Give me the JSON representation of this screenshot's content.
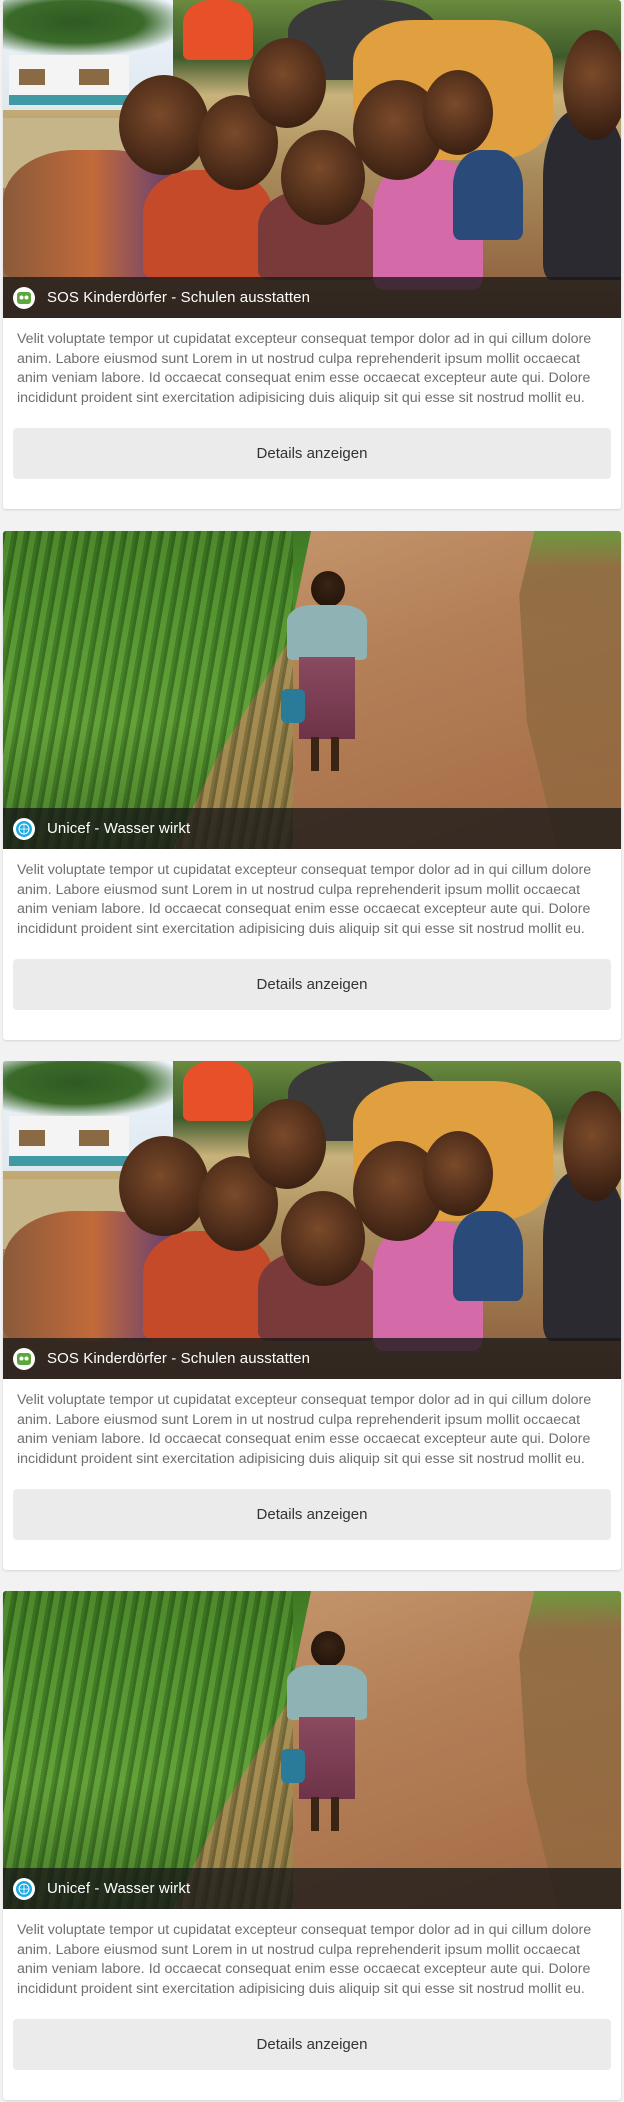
{
  "feed": {
    "cards": [
      {
        "title": "SOS Kinderdörfer - Schulen ausstatten",
        "logo": "sos-kinderdorf-logo",
        "image": "children-group-photo",
        "text": "Velit voluptate tempor ut cupidatat excepteur consequat tempor dolor ad in qui cillum dolore anim. Labore eiusmod sunt Lorem in ut nostrud culpa reprehenderit ipsum mollit occaecat anim veniam labore. Id occaecat consequat enim esse occaecat excepteur aute qui. Dolore incididunt proident sint exercitation adipisicing duis aliquip sit qui esse sit nostrud mollit eu.",
        "button_label": "Details anzeigen"
      },
      {
        "title": "Unicef - Wasser wirkt",
        "logo": "unicef-logo",
        "image": "girl-on-path-photo",
        "text": "Velit voluptate tempor ut cupidatat excepteur consequat tempor dolor ad in qui cillum dolore anim. Labore eiusmod sunt Lorem in ut nostrud culpa reprehenderit ipsum mollit occaecat anim veniam labore. Id occaecat consequat enim esse occaecat excepteur aute qui. Dolore incididunt proident sint exercitation adipisicing duis aliquip sit qui esse sit nostrud mollit eu.",
        "button_label": "Details anzeigen"
      },
      {
        "title": "SOS Kinderdörfer - Schulen ausstatten",
        "logo": "sos-kinderdorf-logo",
        "image": "children-group-photo",
        "text": "Velit voluptate tempor ut cupidatat excepteur consequat tempor dolor ad in qui cillum dolore anim. Labore eiusmod sunt Lorem in ut nostrud culpa reprehenderit ipsum mollit occaecat anim veniam labore. Id occaecat consequat enim esse occaecat excepteur aute qui. Dolore incididunt proident sint exercitation adipisicing duis aliquip sit qui esse sit nostrud mollit eu.",
        "button_label": "Details anzeigen"
      },
      {
        "title": "Unicef - Wasser wirkt",
        "logo": "unicef-logo",
        "image": "girl-on-path-photo",
        "text": "Velit voluptate tempor ut cupidatat excepteur consequat tempor dolor ad in qui cillum dolore anim. Labore eiusmod sunt Lorem in ut nostrud culpa reprehenderit ipsum mollit occaecat anim veniam labore. Id occaecat consequat enim esse occaecat excepteur aute qui. Dolore incididunt proident sint exercitation adipisicing duis aliquip sit qui esse sit nostrud mollit eu.",
        "button_label": "Details anzeigen"
      }
    ]
  },
  "colors": {
    "page_background": "#f2f2f2",
    "card_background": "#ffffff",
    "caption_bar": "#181818",
    "button_background": "#ebebeb",
    "body_text": "#6e6e6e",
    "sos_green": "#5aa83c",
    "unicef_blue": "#1cabe2"
  }
}
